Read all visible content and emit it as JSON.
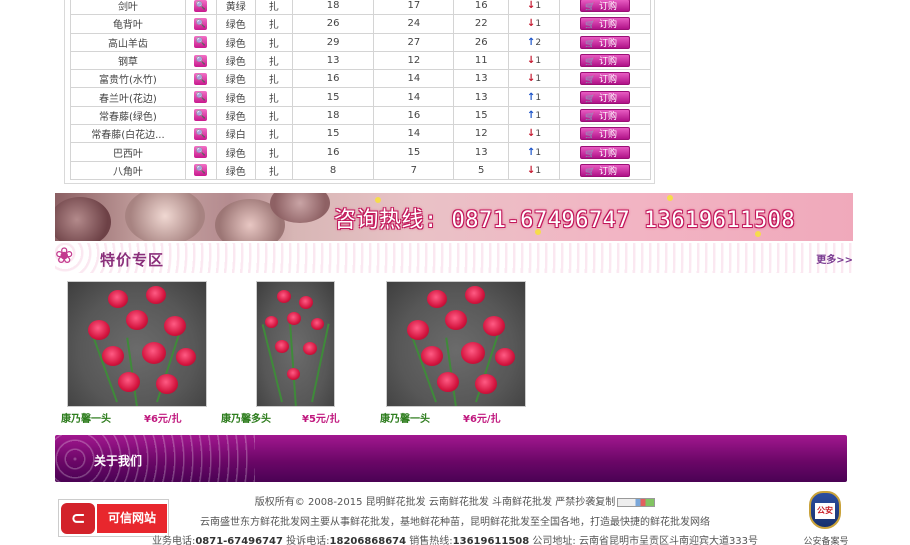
{
  "price_table": {
    "view_icon": "magnifier-icon",
    "cart_icon": "cart-icon",
    "buy_label": "订购",
    "rows": [
      {
        "name": "剑叶",
        "color": "黄绿",
        "unit": "扎",
        "p1": "18",
        "p2": "17",
        "p3": "16",
        "trend": "down",
        "trend_value": "1"
      },
      {
        "name": "龟背叶",
        "color": "绿色",
        "unit": "扎",
        "p1": "26",
        "p2": "24",
        "p3": "22",
        "trend": "down",
        "trend_value": "1"
      },
      {
        "name": "高山羊齿",
        "color": "绿色",
        "unit": "扎",
        "p1": "29",
        "p2": "27",
        "p3": "26",
        "trend": "up",
        "trend_value": "2"
      },
      {
        "name": "钢草",
        "color": "绿色",
        "unit": "扎",
        "p1": "13",
        "p2": "12",
        "p3": "11",
        "trend": "down",
        "trend_value": "1"
      },
      {
        "name": "富贵竹(水竹)",
        "color": "绿色",
        "unit": "扎",
        "p1": "16",
        "p2": "14",
        "p3": "13",
        "trend": "down",
        "trend_value": "1"
      },
      {
        "name": "春兰叶(花边)",
        "color": "绿色",
        "unit": "扎",
        "p1": "15",
        "p2": "14",
        "p3": "13",
        "trend": "up",
        "trend_value": "1"
      },
      {
        "name": "常春藤(绿色)",
        "color": "绿色",
        "unit": "扎",
        "p1": "18",
        "p2": "16",
        "p3": "15",
        "trend": "up",
        "trend_value": "1"
      },
      {
        "name": "常春藤(白花边...",
        "color": "绿白",
        "unit": "扎",
        "p1": "15",
        "p2": "14",
        "p3": "12",
        "trend": "down",
        "trend_value": "1"
      },
      {
        "name": "巴西叶",
        "color": "绿色",
        "unit": "扎",
        "p1": "16",
        "p2": "15",
        "p3": "13",
        "trend": "up",
        "trend_value": "1"
      },
      {
        "name": "八角叶",
        "color": "绿色",
        "unit": "扎",
        "p1": "8",
        "p2": "7",
        "p3": "5",
        "trend": "down",
        "trend_value": "1"
      }
    ]
  },
  "banner": {
    "hotline": "咨询热线: 0871-67496747  13619611508"
  },
  "special": {
    "title": "特价专区",
    "more": "更多>>",
    "products": [
      {
        "name": "康乃馨一头",
        "price": "¥6元/扎"
      },
      {
        "name": "康乃馨多头",
        "price": "¥5元/扎"
      },
      {
        "name": "康乃馨一头",
        "price": "¥6元/扎"
      }
    ]
  },
  "about": {
    "label": "关于我们"
  },
  "footer": {
    "copyright": "版权所有© 2008-2015 昆明鲜花批发 云南鲜花批发 斗南鲜花批发 严禁抄袭复制",
    "intro": "云南盛世东方鲜花批发网主要从事鲜花批发，基地鲜花种苗，昆明鲜花批发至全国各地，打造最快捷的鲜花批发网络",
    "contact_prefix": "业务电话:",
    "business_phone": "0871-67496747",
    "complaint_prefix": "投诉电话:",
    "complaint_phone": "18206868674",
    "sales_prefix": "销售热线:",
    "sales_phone": "13619611508",
    "address": "公司地址: 云南省昆明市呈贡区斗南迎宾大道333号",
    "trust_label": "可信网站",
    "police_label": "公安备案号"
  }
}
